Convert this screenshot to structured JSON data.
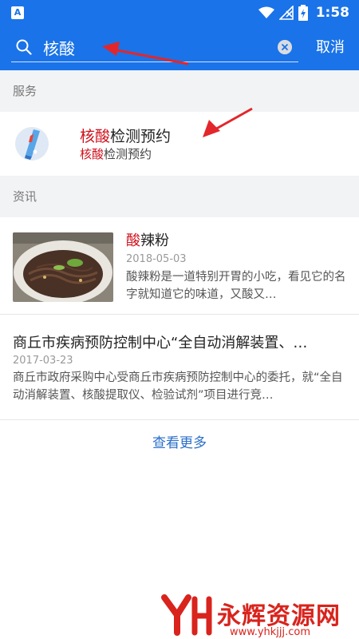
{
  "status_bar": {
    "app_icon": "A",
    "time": "1:58"
  },
  "search": {
    "value": "核酸",
    "cancel_label": "取消"
  },
  "sections": {
    "services": "服务",
    "news": "资讯"
  },
  "service": {
    "title_highlight": "核酸",
    "title_rest": "检测预约",
    "subtitle_highlight": "核酸",
    "subtitle_rest": "检测预约"
  },
  "news": [
    {
      "title_highlight": "酸",
      "title_rest": "辣粉",
      "date": "2018-05-03",
      "summary": "酸辣粉是一道特别开胃的小吃，看见它的名字就知道它的味道，又酸又…"
    },
    {
      "title": "商丘市疾病预防控制中心“全自动消解装置、…",
      "date": "2017-03-23",
      "summary": "商丘市政府采购中心受商丘市疾病预防控制中心的委托，就“全自动消解装置、核酸提取仪、检验试剂”项目进行竞…"
    }
  ],
  "see_more": "查看更多",
  "watermark": {
    "name": "永辉资源网",
    "url": "www.yhkjjj.com"
  },
  "colors": {
    "header": "#1a73e8",
    "highlight": "#d0101b",
    "link": "#2a6fc9"
  }
}
